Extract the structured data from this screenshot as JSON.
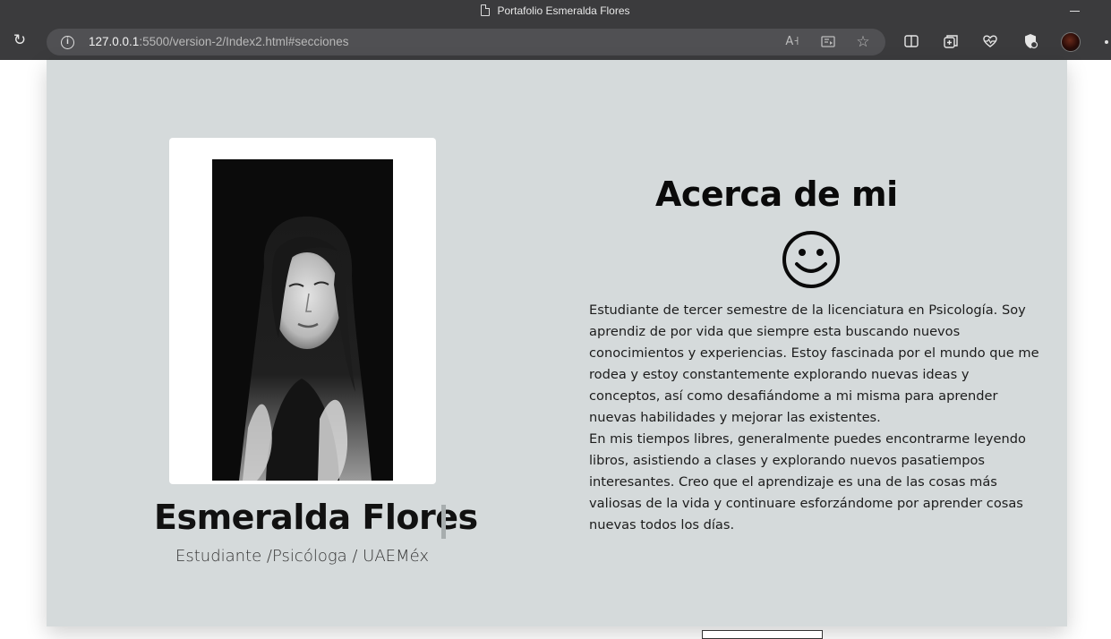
{
  "window": {
    "title": "Portafolio Esmeralda Flores"
  },
  "toolbar": {
    "url_host": "127.0.0.1",
    "url_rest": ":5500/version-2/Index2.html#secciones",
    "icons": {
      "reload": "reload-icon",
      "site_info": "info-icon",
      "read_aloud": "read-aloud-icon",
      "immersive_reader": "immersive-reader-icon",
      "favorite": "star-icon",
      "split_screen": "split-screen-icon",
      "collections": "collections-icon",
      "browser_essentials": "heart-pulse-icon",
      "extensions": "shield-icon",
      "profile": "avatar",
      "more": "more-icon"
    }
  },
  "profile": {
    "name": "Esmeralda Flores",
    "role": "Estudiante /Psicóloga / UAEMéx"
  },
  "about": {
    "title": "Acerca de mi",
    "icon": "smiley-icon",
    "paragraph1": "Estudiante de tercer semestre de la licenciatura en Psicología. Soy aprendiz de por vida que siempre esta buscando nuevos conocimientos y experiencias. Estoy fascinada por el mundo que me rodea y estoy constantemente explorando nuevas ideas y conceptos, así como desafiándome a mi misma para aprender nuevas habilidades y mejorar las existentes.",
    "paragraph2": "En mis tiempos libres, generalmente puedes encontrarme leyendo libros, asistiendo a clases y explorando nuevos pasatiempos interesantes. Creo que el aprendizaje es una de las cosas más valiosas de la vida y continuare esforzándome por aprender cosas nuevas todos los días."
  },
  "colors": {
    "panel_bg": "#d5dadb",
    "chrome_bg": "#3b3b3d",
    "address_bg": "#505053",
    "text": "#111111"
  }
}
